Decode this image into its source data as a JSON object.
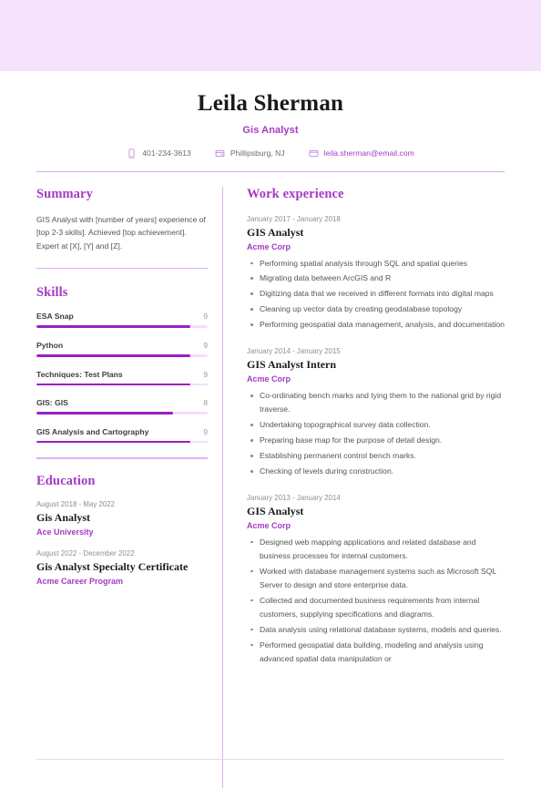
{
  "theme": {
    "accent": "#a33bc2",
    "bar_fill": "#9b1fc1",
    "bar_track": "#f2dff8",
    "header_band": "#f4e3fa",
    "rule": "#dcb3ee"
  },
  "header": {
    "full_name": "Leila Sherman",
    "job_title": "Gis Analyst",
    "contacts": [
      {
        "icon": "phone-icon",
        "text": "401-234-3613"
      },
      {
        "icon": "location-icon",
        "text": "Phillipsburg, NJ"
      },
      {
        "icon": "email-icon",
        "text": "leila.sherman@email.com"
      }
    ]
  },
  "summary": {
    "title": "Summary",
    "text": "GIS Analyst with [number of years] experience of [top 2-3 skills]. Achieved [top achievement]. Expert at [X], [Y] and [Z]."
  },
  "skills": {
    "title": "Skills",
    "max": 10,
    "items": [
      {
        "name": "ESA Snap",
        "level": "9",
        "percent": 90
      },
      {
        "name": "Python",
        "level": "9",
        "percent": 90
      },
      {
        "name": "Techniques: Test Plans",
        "level": "9",
        "percent": 90
      },
      {
        "name": "GIS: GIS",
        "level": "8",
        "percent": 80
      },
      {
        "name": "GIS Analysis and Cartography",
        "level": "9",
        "percent": 90
      }
    ]
  },
  "education": {
    "title": "Education",
    "entries": [
      {
        "date": "August 2018 - May 2022",
        "role": "Gis Analyst",
        "org": "Ace University"
      },
      {
        "date": "August 2022 - December 2022",
        "role": "Gis Analyst Specialty Certificate",
        "org": "Acme Career Program"
      }
    ]
  },
  "work_experience": {
    "title": "Work experience",
    "entries": [
      {
        "date": "January 2017 - January 2018",
        "role": "GIS Analyst",
        "org": "Acme Corp",
        "bullets": [
          "Performing spatial analysis through SQL and spatial queries",
          "Migrating data between ArcGIS and R",
          "Digitizing data that we received in different formats into digital maps",
          "Cleaning up vector data by creating geodatabase topology",
          "Performing geospatial data management, analysis, and documentation"
        ]
      },
      {
        "date": "January 2014 - January 2015",
        "role": "GIS Analyst Intern",
        "org": "Acme Corp",
        "bullets": [
          "Co-ordinating bench marks and tying them to the national grid by rigid traverse.",
          "Undertaking topographical survey data collection.",
          "Preparing base map for the purpose of detail design.",
          "Establishing permanent control bench marks.",
          "Checking of levels during construction."
        ]
      },
      {
        "date": "January 2013 - January 2014",
        "role": "GIS Analyst",
        "org": "Acme Corp",
        "bullets": [
          "Designed web mapping applications and related database and business processes for internal customers.",
          "Worked with database management systems such as Microsoft SQL Server to design and store enterprise data.",
          "Collected and documented business requirements from internal customers, supplying specifications and diagrams.",
          "Data analysis using relational database systems, models and queries.",
          "Performed geospatial data building, modeling and analysis using advanced spatial data manipulation or"
        ]
      }
    ]
  }
}
